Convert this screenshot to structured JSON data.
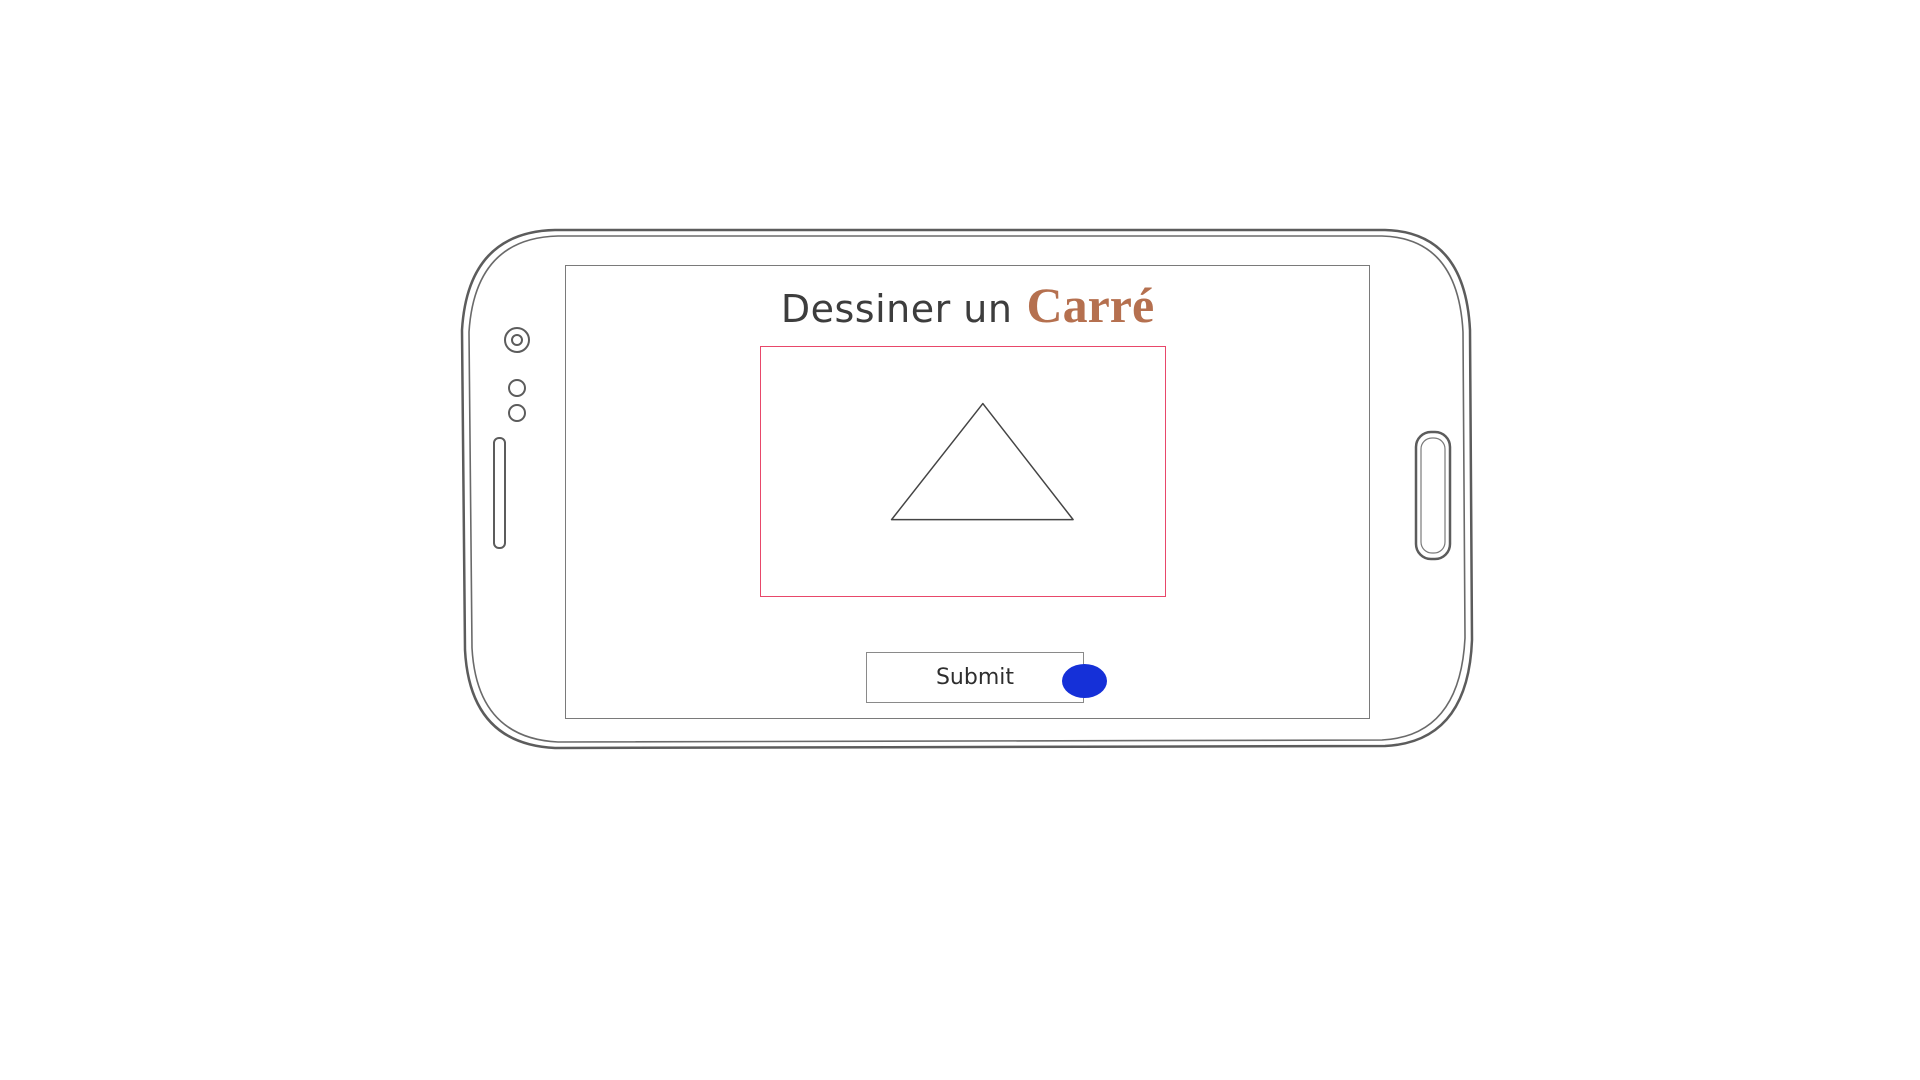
{
  "title": {
    "prefix": "Dessiner un",
    "shape_word": "Carré",
    "shape_word_color": "#b5704f"
  },
  "canvas": {
    "drawn_shape": "triangle",
    "border_color": "#e8476a"
  },
  "submit": {
    "label": "Submit"
  },
  "indicator": {
    "color": "#1530d8"
  },
  "device": {
    "type": "smartphone-landscape",
    "icons": [
      "camera-icon",
      "sensor-icon",
      "speaker-icon",
      "home-button"
    ]
  }
}
